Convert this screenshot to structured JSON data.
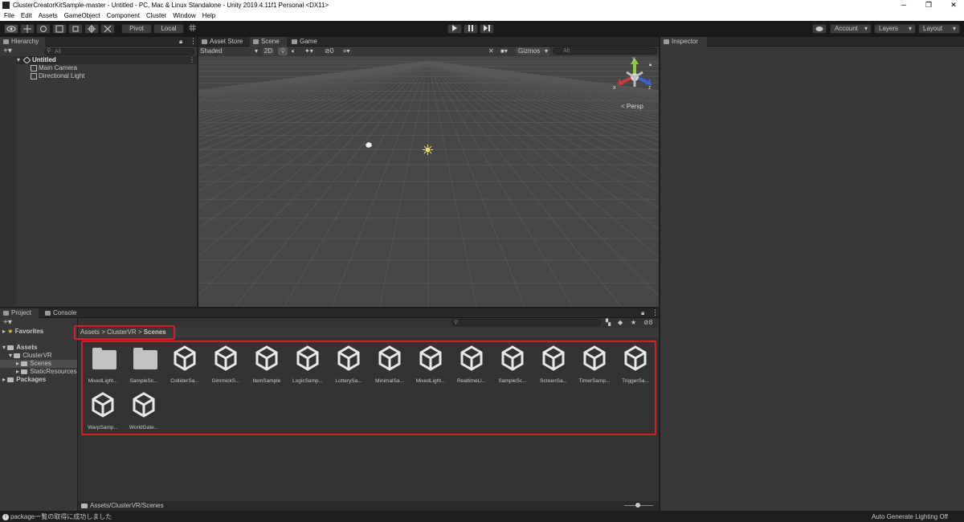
{
  "window": {
    "title": "ClusterCreatorKitSample-master - Untitled - PC, Mac & Linux Standalone - Unity 2019.4.11f1 Personal <DX11>",
    "minimize": "─",
    "maximize": "❐",
    "close": "✕"
  },
  "menu": [
    "File",
    "Edit",
    "Assets",
    "GameObject",
    "Component",
    "Cluster",
    "Window",
    "Help"
  ],
  "toolbar": {
    "pivot": "Pivot",
    "local": "Local",
    "account": "Account",
    "layers": "Layers",
    "layout": "Layout"
  },
  "hierarchy": {
    "tab": "Hierarchy",
    "search_placeholder": "All",
    "scene": "Untitled",
    "objects": [
      "Main Camera",
      "Directional Light"
    ]
  },
  "scene_view": {
    "tabs": [
      "Asset Store",
      "Scene",
      "Game"
    ],
    "shading": "Shaded",
    "mode_2d": "2D",
    "hidden_count": "0",
    "gizmos": "Gizmos",
    "search_placeholder": "All",
    "projection": "Persp",
    "axes": {
      "x": "x",
      "y": "y",
      "z": "z"
    }
  },
  "inspector": {
    "tab": "Inspector"
  },
  "project": {
    "tabs": [
      "Project",
      "Console"
    ],
    "tree": {
      "favorites": "Favorites",
      "assets": "Assets",
      "clustervr": "ClusterVR",
      "scenes": "Scenes",
      "static_resources": "StaticResources",
      "packages": "Packages"
    },
    "breadcrumb": {
      "part1": "Assets",
      "part2": "ClusterVR",
      "part3": "Scenes"
    },
    "hidden_count": "8",
    "items": [
      {
        "name": "MixedLight...",
        "kind": "folder"
      },
      {
        "name": "SampleSc...",
        "kind": "folder"
      },
      {
        "name": "ColliderSa...",
        "kind": "unity"
      },
      {
        "name": "GimmickS...",
        "kind": "unity"
      },
      {
        "name": "ItemSample",
        "kind": "unity"
      },
      {
        "name": "LogicSamp...",
        "kind": "unity"
      },
      {
        "name": "LotterySa...",
        "kind": "unity"
      },
      {
        "name": "MinimalSa...",
        "kind": "unity"
      },
      {
        "name": "MixedLight...",
        "kind": "unity"
      },
      {
        "name": "RealtimeLi...",
        "kind": "unity"
      },
      {
        "name": "SampleSc...",
        "kind": "unity"
      },
      {
        "name": "ScreenSa...",
        "kind": "unity"
      },
      {
        "name": "TimerSamp...",
        "kind": "unity"
      },
      {
        "name": "TriggerSa...",
        "kind": "unity"
      },
      {
        "name": "WarpSamp...",
        "kind": "unity"
      },
      {
        "name": "WorldGate...",
        "kind": "unity"
      }
    ],
    "path": "Assets/ClusterVR/Scenes"
  },
  "status": {
    "message": "packageー覧の取得に成功しました",
    "right": "Auto Generate Lighting Off"
  },
  "colors": {
    "highlight": "#d0202a",
    "scene_bg": "#464646",
    "panel_bg": "#383838"
  }
}
